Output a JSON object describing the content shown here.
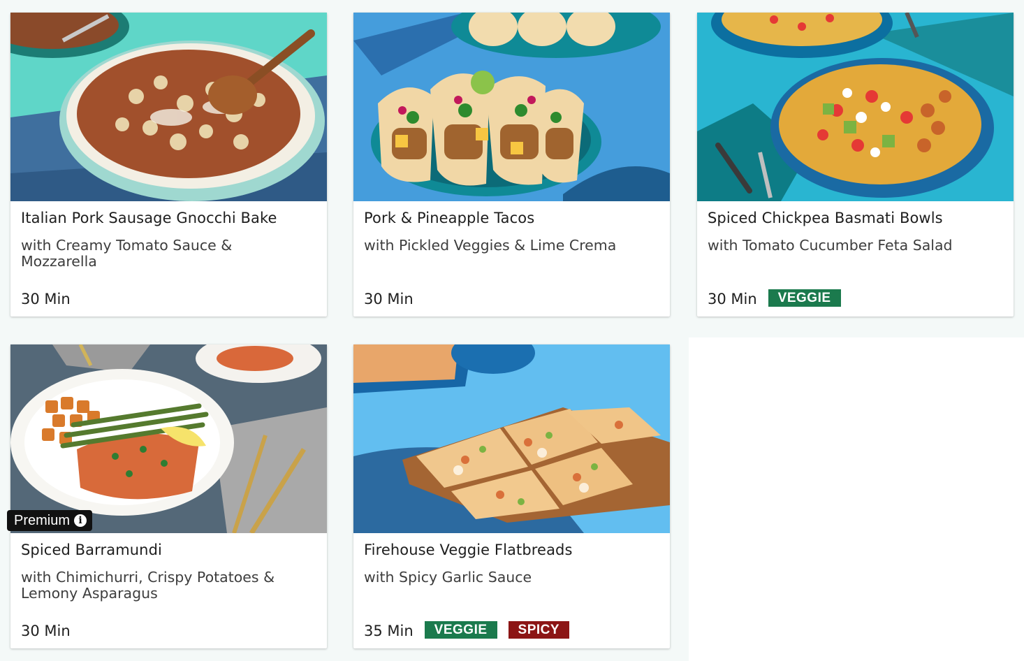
{
  "recipes": [
    {
      "title": "Italian Pork Sausage Gnocchi Bake",
      "subtitle": "with Creamy Tomato Sauce & Mozzarella",
      "time": "30 Min",
      "tags": []
    },
    {
      "title": "Pork & Pineapple Tacos",
      "subtitle": "with Pickled Veggies & Lime Crema",
      "time": "30 Min",
      "tags": []
    },
    {
      "title": "Spiced Chickpea Basmati Bowls",
      "subtitle": "with Tomato Cucumber Feta Salad",
      "time": "30 Min",
      "tags": [
        "VEGGIE"
      ]
    },
    {
      "title": "Spiced Barramundi",
      "subtitle": "with Chimichurri, Crispy Potatoes & Lemony Asparagus",
      "time": "30 Min",
      "badge": "Premium",
      "badge_icon": "info-icon",
      "tags": []
    },
    {
      "title": "Firehouse Veggie Flatbreads",
      "subtitle": "with Spicy Garlic Sauce",
      "time": "35 Min",
      "tags": [
        "VEGGIE",
        "SPICY"
      ]
    }
  ],
  "colors": {
    "veggie_tag": "#1b7a4d",
    "spicy_tag": "#8c1515",
    "premium_badge": "#111111"
  }
}
